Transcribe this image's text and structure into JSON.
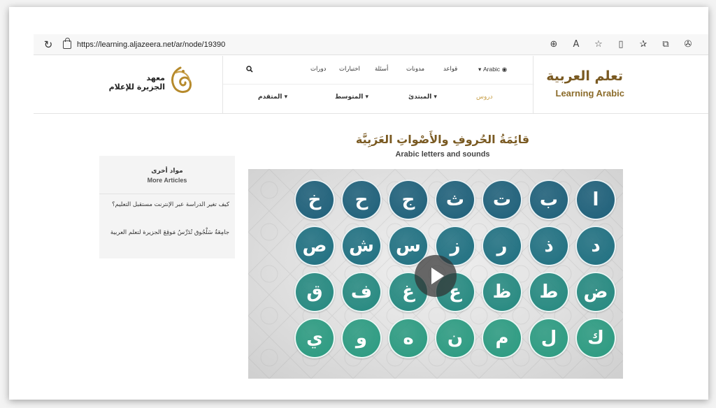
{
  "browser": {
    "url": "https://learning.aljazeera.net/ar/node/19390",
    "reload_icon": "reload-icon",
    "icons": [
      "zoom-icon",
      "read-aloud-icon",
      "favorite-star-icon",
      "split-screen-icon",
      "favorites-icon",
      "collections-icon",
      "extensions-icon"
    ]
  },
  "header": {
    "brand_ar": "تعلم العربية",
    "brand_en": "Learning Arabic",
    "logo_line1": "معهد",
    "logo_line2": "الجزيرة للإعلام",
    "nav_top": {
      "lang": "Arabic",
      "grammar": "قواعد",
      "blogs": "مدونات",
      "questions": "أسئلة",
      "tests": "اختبارات",
      "courses": "دورات"
    },
    "nav_bottom": {
      "lessons": "دروس",
      "beginner": "المبتدئ",
      "intermediate": "المتوسط",
      "advanced": "المتقدم"
    }
  },
  "page": {
    "title_ar": "قائِمَةُ الحُروفِ والأَصْواتِ العَرَبِيَّة",
    "title_en": "Arabic letters and sounds"
  },
  "sidebar": {
    "title_ar": "مواد أخرى",
    "title_en": "More Articles",
    "items": [
      "كيف تغير الدراسة عبر الإنترنت مستقبل التعليم؟",
      "جامِعَةُ سَلْجُوق تُدَرِّسُ مَوقِعَ الجزيرة لتعلم العربية"
    ]
  },
  "video": {
    "letters": [
      [
        "ا",
        "ب",
        "ت",
        "ث",
        "ج",
        "ح",
        "خ"
      ],
      [
        "د",
        "ذ",
        "ر",
        "ز",
        "س",
        "ش",
        "ص"
      ],
      [
        "ض",
        "ط",
        "ظ",
        "ع",
        "غ",
        "ف",
        "ق"
      ],
      [
        "ك",
        "ل",
        "م",
        "ن",
        "ه",
        "و",
        "ي"
      ]
    ],
    "row_colors": [
      "#1d5f79",
      "#1e6f80",
      "#24887f",
      "#2a9a80"
    ]
  }
}
